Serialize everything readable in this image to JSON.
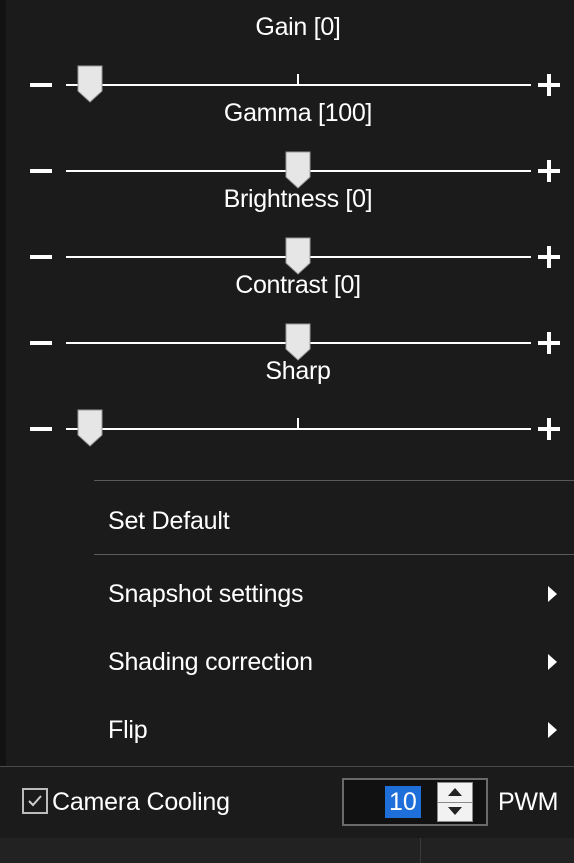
{
  "sliders": [
    {
      "title": "Gain [0]",
      "minus": "−",
      "plus": "+",
      "level": 0.0
    },
    {
      "title": "Gamma [100]",
      "minus": "−",
      "plus": "+",
      "level": 0.5
    },
    {
      "title": "Brightness [0]",
      "minus": "−",
      "plus": "+",
      "level": 0.5
    },
    {
      "title": "Contrast [0]",
      "minus": "−",
      "plus": "+",
      "level": 0.5
    },
    {
      "title": "Sharp",
      "minus": "−",
      "plus": "+",
      "level": 0.0
    }
  ],
  "menu": {
    "items": [
      {
        "label": "Set Default",
        "has_submenu": false
      },
      {
        "label": "Snapshot settings",
        "has_submenu": true
      },
      {
        "label": "Shading correction",
        "has_submenu": true
      },
      {
        "label": "Flip",
        "has_submenu": true
      }
    ]
  },
  "cooling": {
    "checkbox_label": "Camera Cooling",
    "checked": true,
    "value": "10",
    "unit_label": "PWM"
  },
  "colors": {
    "background": "#1b1b1b",
    "text": "#ffffff",
    "selection": "#1e6fd9"
  }
}
